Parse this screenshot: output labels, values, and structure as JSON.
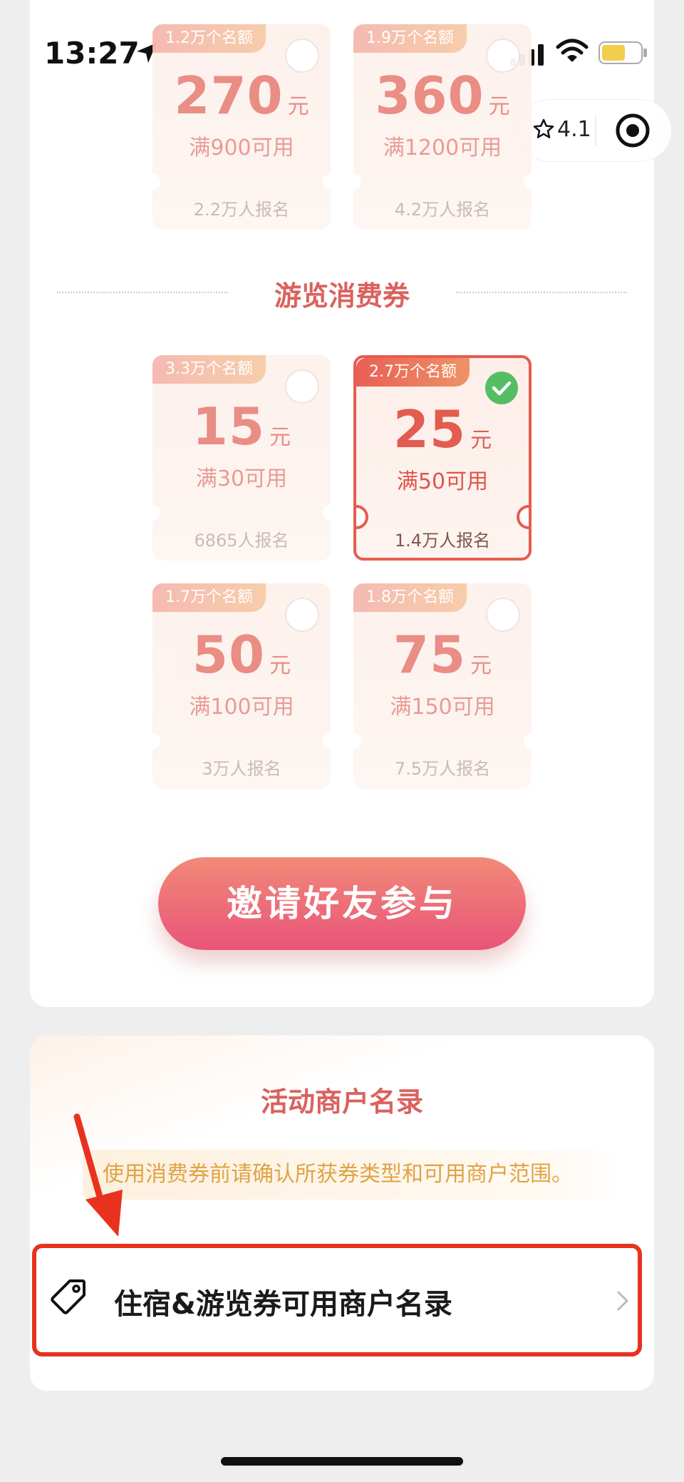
{
  "status_bar": {
    "time": "13:27"
  },
  "capsule": {
    "rating": "4.1"
  },
  "stay_coupons": [
    {
      "quota": "1.2万个名额",
      "amount": "270",
      "unit": "元",
      "condition": "满900可用",
      "signups": "2.2万人报名",
      "selected": false
    },
    {
      "quota": "1.9万个名额",
      "amount": "360",
      "unit": "元",
      "condition": "满1200可用",
      "signups": "4.2万人报名",
      "selected": false
    }
  ],
  "tour_section": {
    "title": "游览消费券"
  },
  "tour_coupons": [
    {
      "quota": "3.3万个名额",
      "amount": "15",
      "unit": "元",
      "condition": "满30可用",
      "signups": "6865人报名",
      "selected": false
    },
    {
      "quota": "2.7万个名额",
      "amount": "25",
      "unit": "元",
      "condition": "满50可用",
      "signups": "1.4万人报名",
      "selected": true
    },
    {
      "quota": "1.7万个名额",
      "amount": "50",
      "unit": "元",
      "condition": "满100可用",
      "signups": "3万人报名",
      "selected": false
    },
    {
      "quota": "1.8万个名额",
      "amount": "75",
      "unit": "元",
      "condition": "满150可用",
      "signups": "7.5万人报名",
      "selected": false
    }
  ],
  "invite_button": {
    "label": "邀请好友参与"
  },
  "merchants": {
    "title": "活动商户名录",
    "notice": "使用消费券前请确认所获券类型和可用商户范围。",
    "row_label": "住宿&游览券可用商户名录"
  },
  "colors": {
    "accent": "#e25447",
    "annotation": "#e8321f",
    "check": "#4cbb5d"
  }
}
